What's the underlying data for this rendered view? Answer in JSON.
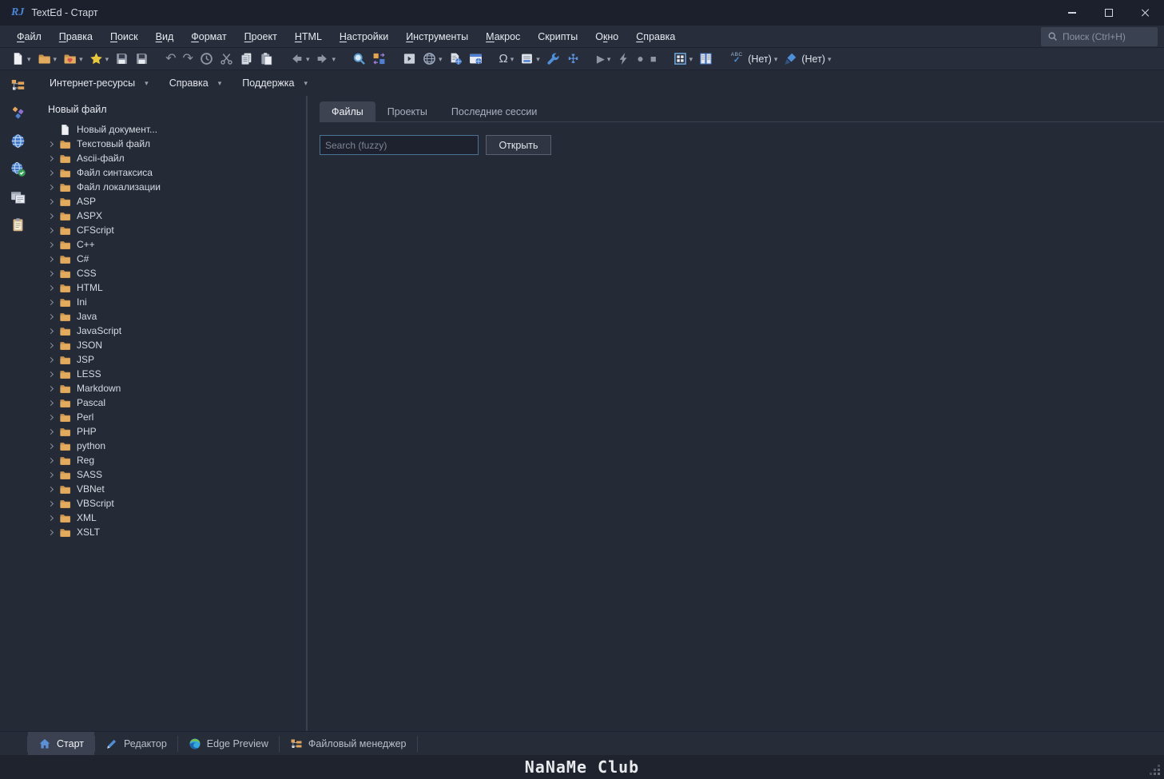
{
  "window": {
    "logo": "RJ",
    "title": "TextEd - Старт"
  },
  "menu_bar": {
    "items": [
      {
        "id": "file",
        "label": "Файл",
        "hot": 0
      },
      {
        "id": "edit",
        "label": "Правка",
        "hot": 0
      },
      {
        "id": "search",
        "label": "Поиск",
        "hot": 0
      },
      {
        "id": "view",
        "label": "Вид",
        "hot": 0
      },
      {
        "id": "format",
        "label": "Формат",
        "hot": 0
      },
      {
        "id": "project",
        "label": "Проект",
        "hot": 0
      },
      {
        "id": "html",
        "label": "HTML",
        "hot": 0
      },
      {
        "id": "settings",
        "label": "Настройки",
        "hot": 0
      },
      {
        "id": "tools",
        "label": "Инструменты",
        "hot": 0
      },
      {
        "id": "macro",
        "label": "Макрос",
        "hot": 0
      },
      {
        "id": "scripts",
        "label": "Скрипты",
        "hot": -1
      },
      {
        "id": "window",
        "label": "Окно",
        "hot": 1
      },
      {
        "id": "help",
        "label": "Справка",
        "hot": 0
      }
    ],
    "search_placeholder": "Поиск (Ctrl+H)"
  },
  "toolbar": {
    "groups": [
      [
        {
          "id": "new-file",
          "icon": "page",
          "dropdown": true
        },
        {
          "id": "open-file",
          "icon": "folder",
          "dropdown": true
        },
        {
          "id": "open-favorite",
          "icon": "folder-heart",
          "dropdown": true
        },
        {
          "id": "favorites",
          "icon": "star",
          "dropdown": true
        },
        {
          "id": "save",
          "icon": "floppy"
        },
        {
          "id": "save-all",
          "icon": "floppy-all"
        }
      ],
      [
        {
          "id": "undo",
          "glyph": "undo"
        },
        {
          "id": "redo",
          "glyph": "redo"
        },
        {
          "id": "history",
          "icon": "clock"
        },
        {
          "id": "cut",
          "icon": "scissors"
        },
        {
          "id": "copy",
          "icon": "copy"
        },
        {
          "id": "paste",
          "icon": "paste"
        }
      ],
      [
        {
          "id": "navigate-back",
          "icon": "arrow-left",
          "dropdown": true
        },
        {
          "id": "navigate-forward",
          "icon": "arrow-right",
          "dropdown": true
        }
      ],
      [
        {
          "id": "search",
          "icon": "search"
        },
        {
          "id": "compare",
          "icon": "compare"
        }
      ],
      [
        {
          "id": "panel-toggle",
          "icon": "panel"
        },
        {
          "id": "browser-preview",
          "icon": "globe",
          "dropdown": true
        },
        {
          "id": "document-preview",
          "icon": "doc-globe"
        },
        {
          "id": "window-preview",
          "icon": "window-globe"
        }
      ],
      [
        {
          "id": "special-characters",
          "glyph": "omega",
          "dropdown": true
        },
        {
          "id": "code-layout",
          "icon": "validate",
          "dropdown": true
        },
        {
          "id": "tools",
          "icon": "wrench"
        },
        {
          "id": "plugins",
          "icon": "puzzle"
        }
      ],
      [
        {
          "id": "run",
          "glyph": "play",
          "dropdown": true
        },
        {
          "id": "quick-run",
          "icon": "lightning"
        },
        {
          "id": "record-macro",
          "glyph": "record"
        },
        {
          "id": "stop-macro",
          "glyph": "stop"
        }
      ],
      [
        {
          "id": "layout-grid",
          "icon": "grid",
          "dropdown": true
        },
        {
          "id": "layout-columns",
          "icon": "columns"
        }
      ],
      [
        {
          "id": "spellcheck",
          "icon": "spellcheck",
          "label": "(Нет)",
          "dropdown": true
        },
        {
          "id": "syntax-scheme",
          "icon": "brush",
          "label": "(Нет)",
          "dropdown": true
        }
      ]
    ]
  },
  "quick_bar": {
    "items": [
      {
        "id": "internet-resources",
        "label": "Интернет-ресурсы"
      },
      {
        "id": "help",
        "label": "Справка"
      },
      {
        "id": "support",
        "label": "Поддержка"
      }
    ]
  },
  "activity_bar": {
    "items": [
      {
        "id": "file-manager",
        "icon": "tree"
      },
      {
        "id": "snippets",
        "icon": "snippets"
      },
      {
        "id": "web",
        "icon": "globe-blue"
      },
      {
        "id": "web-check",
        "icon": "globe-check"
      },
      {
        "id": "preview",
        "icon": "preview"
      },
      {
        "id": "clipboard",
        "icon": "clipboard"
      }
    ]
  },
  "tree_panel": {
    "header": "Новый файл",
    "items": [
      {
        "label": "Новый документ...",
        "icon": "page",
        "expandable": false
      },
      {
        "label": "Текстовый файл",
        "icon": "folder",
        "expandable": true
      },
      {
        "label": "Ascii-файл",
        "icon": "folder",
        "expandable": true
      },
      {
        "label": "Файл синтаксиса",
        "icon": "folder",
        "expandable": true
      },
      {
        "label": "Файл локализации",
        "icon": "folder",
        "expandable": true
      },
      {
        "label": "ASP",
        "icon": "folder",
        "expandable": true
      },
      {
        "label": "ASPX",
        "icon": "folder",
        "expandable": true
      },
      {
        "label": "CFScript",
        "icon": "folder",
        "expandable": true
      },
      {
        "label": "C++",
        "icon": "folder",
        "expandable": true
      },
      {
        "label": "C#",
        "icon": "folder",
        "expandable": true
      },
      {
        "label": "CSS",
        "icon": "folder",
        "expandable": true
      },
      {
        "label": "HTML",
        "icon": "folder",
        "expandable": true
      },
      {
        "label": "Ini",
        "icon": "folder",
        "expandable": true
      },
      {
        "label": "Java",
        "icon": "folder",
        "expandable": true
      },
      {
        "label": "JavaScript",
        "icon": "folder",
        "expandable": true
      },
      {
        "label": "JSON",
        "icon": "folder",
        "expandable": true
      },
      {
        "label": "JSP",
        "icon": "folder",
        "expandable": true
      },
      {
        "label": "LESS",
        "icon": "folder",
        "expandable": true
      },
      {
        "label": "Markdown",
        "icon": "folder",
        "expandable": true
      },
      {
        "label": "Pascal",
        "icon": "folder",
        "expandable": true
      },
      {
        "label": "Perl",
        "icon": "folder",
        "expandable": true
      },
      {
        "label": "PHP",
        "icon": "folder",
        "expandable": true
      },
      {
        "label": "python",
        "icon": "folder",
        "expandable": true
      },
      {
        "label": "Reg",
        "icon": "folder",
        "expandable": true
      },
      {
        "label": "SASS",
        "icon": "folder",
        "expandable": true
      },
      {
        "label": "VBNet",
        "icon": "folder",
        "expandable": true
      },
      {
        "label": "VBScript",
        "icon": "folder",
        "expandable": true
      },
      {
        "label": "XML",
        "icon": "folder",
        "expandable": true
      },
      {
        "label": "XSLT",
        "icon": "folder",
        "expandable": true
      }
    ]
  },
  "main": {
    "tabs": [
      {
        "id": "files",
        "label": "Файлы",
        "active": true
      },
      {
        "id": "projects",
        "label": "Проекты",
        "active": false
      },
      {
        "id": "recent-sessions",
        "label": "Последние сессии",
        "active": false
      }
    ],
    "search_placeholder": "Search (fuzzy)",
    "open_button": "Открыть"
  },
  "status_bar": {
    "tabs": [
      {
        "id": "start",
        "label": "Старт",
        "icon": "home",
        "active": true
      },
      {
        "id": "editor",
        "label": "Редактор",
        "icon": "pencil",
        "active": false
      },
      {
        "id": "edge-preview",
        "label": "Edge Preview",
        "icon": "edge",
        "active": false
      },
      {
        "id": "file-manager",
        "label": "Файловый менеджер",
        "icon": "tree",
        "active": false
      }
    ]
  },
  "footer": {
    "watermark": "NaNaMe Club"
  },
  "glyphs": {
    "undo": "↶",
    "redo": "↷",
    "play": "▶",
    "record": "●",
    "stop": "■",
    "caret": "▾",
    "omega": "Ω",
    "spell_abc": "ABC",
    "spell_check": "✓"
  },
  "colors": {
    "accent": "#4f8fd8",
    "folder": "#e0a45c",
    "star": "#e8c93e",
    "input_border": "#4a7396",
    "tab_active": "#3d4350",
    "background": "#252a37"
  }
}
